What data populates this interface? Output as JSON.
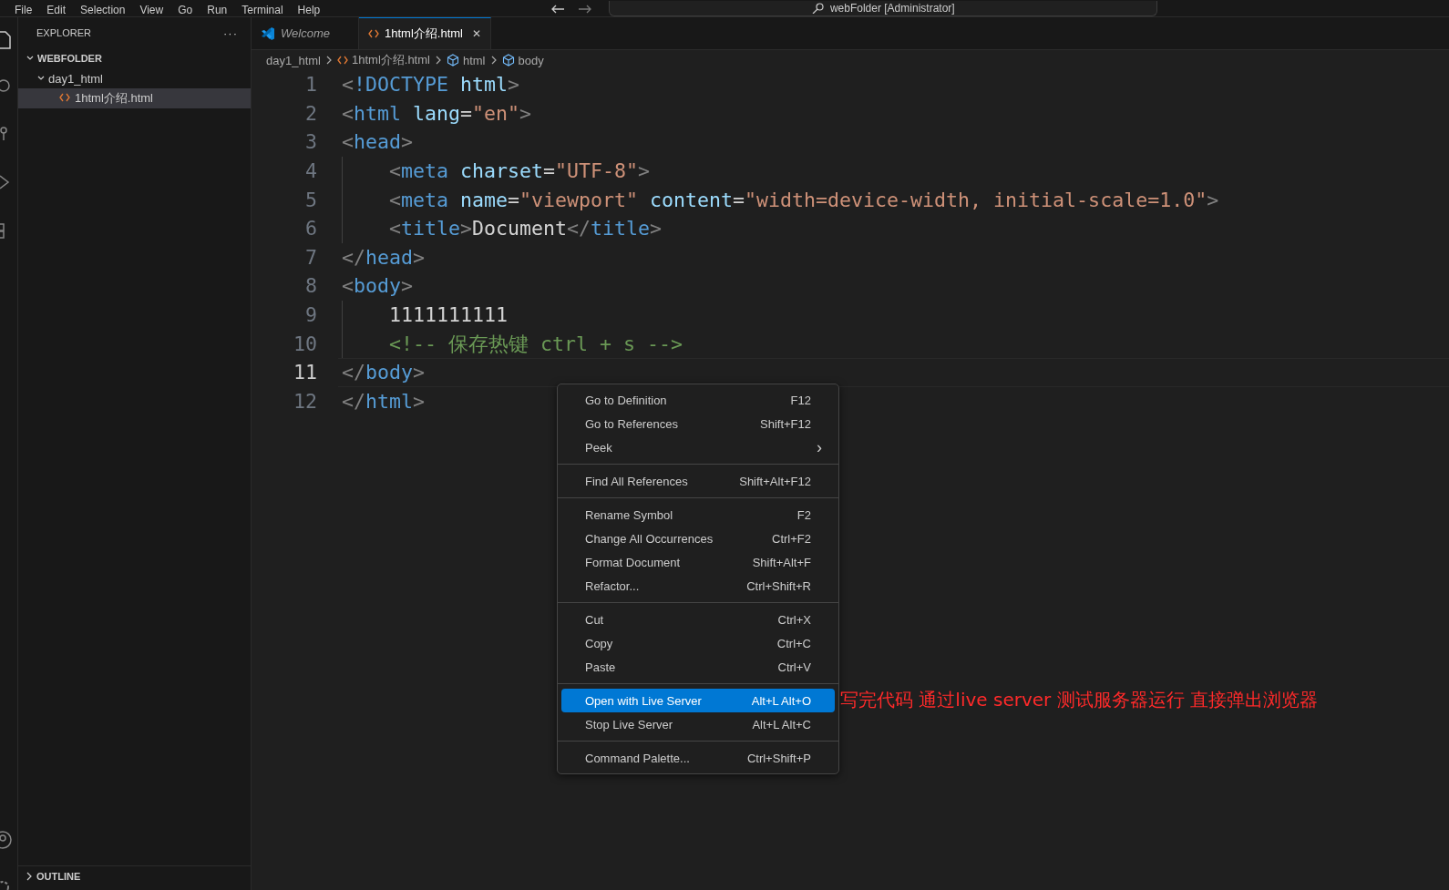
{
  "menu_bar": [
    "File",
    "Edit",
    "Selection",
    "View",
    "Go",
    "Run",
    "Terminal",
    "Help"
  ],
  "command_center": {
    "text": "webFolder [Administrator]"
  },
  "sidebar": {
    "title": "EXPLORER",
    "more": "···",
    "tree": [
      {
        "label": "WEBFOLDER",
        "kind": "root",
        "expanded": true,
        "selected": false,
        "children": [
          {
            "label": "day1_html",
            "expanded": true,
            "selected": false,
            "children": [
              {
                "label": "1html介绍.html",
                "kind": "file",
                "selected": true
              }
            ]
          }
        ]
      }
    ],
    "outline": {
      "label": "OUTLINE",
      "expanded": false
    }
  },
  "tabs": [
    {
      "label": "Welcome",
      "kind": "welcome",
      "selected": false,
      "close": false
    },
    {
      "label": "1html介绍.html",
      "kind": "html",
      "selected": true,
      "close": true
    }
  ],
  "close_glyph": "✕",
  "breadcrumb": [
    {
      "label": "day1_html",
      "kind": "folder"
    },
    {
      "label": "1html介绍.html",
      "kind": "html"
    },
    {
      "label": "html",
      "kind": "element"
    },
    {
      "label": "body",
      "kind": "element"
    }
  ],
  "code": [
    {
      "number": "1",
      "indented": false,
      "current": false,
      "tokens": [
        {
          "kind": "punct",
          "text": "<"
        },
        {
          "kind": "tag",
          "text": "!DOCTYPE"
        },
        {
          "kind": "attr",
          "text": " html"
        },
        {
          "kind": "punct",
          "text": ">"
        }
      ]
    },
    {
      "number": "2",
      "indented": false,
      "current": false,
      "tokens": [
        {
          "kind": "punct",
          "text": "<"
        },
        {
          "kind": "tag",
          "text": "html"
        },
        {
          "kind": "attr",
          "text": " lang"
        },
        {
          "kind": "plain",
          "text": "="
        },
        {
          "kind": "string",
          "text": "\"en\""
        },
        {
          "kind": "punct",
          "text": ">"
        }
      ]
    },
    {
      "number": "3",
      "indented": false,
      "current": false,
      "tokens": [
        {
          "kind": "punct",
          "text": "<"
        },
        {
          "kind": "tag",
          "text": "head"
        },
        {
          "kind": "punct",
          "text": ">"
        }
      ]
    },
    {
      "number": "4",
      "indented": true,
      "current": false,
      "tokens": [
        {
          "kind": "punct",
          "text": "<"
        },
        {
          "kind": "tag",
          "text": "meta"
        },
        {
          "kind": "attr",
          "text": " charset"
        },
        {
          "kind": "plain",
          "text": "="
        },
        {
          "kind": "string",
          "text": "\"UTF-8\""
        },
        {
          "kind": "punct",
          "text": ">"
        }
      ]
    },
    {
      "number": "5",
      "indented": true,
      "current": false,
      "tokens": [
        {
          "kind": "punct",
          "text": "<"
        },
        {
          "kind": "tag",
          "text": "meta"
        },
        {
          "kind": "attr",
          "text": " name"
        },
        {
          "kind": "plain",
          "text": "="
        },
        {
          "kind": "string",
          "text": "\"viewport\""
        },
        {
          "kind": "attr",
          "text": " content"
        },
        {
          "kind": "plain",
          "text": "="
        },
        {
          "kind": "string",
          "text": "\"width=device-width, initial-scale=1.0\""
        },
        {
          "kind": "punct",
          "text": ">"
        }
      ]
    },
    {
      "number": "6",
      "indented": true,
      "current": false,
      "tokens": [
        {
          "kind": "punct",
          "text": "<"
        },
        {
          "kind": "tag",
          "text": "title"
        },
        {
          "kind": "punct",
          "text": ">"
        },
        {
          "kind": "plain",
          "text": "Document"
        },
        {
          "kind": "punct",
          "text": "</"
        },
        {
          "kind": "tag",
          "text": "title"
        },
        {
          "kind": "punct",
          "text": ">"
        }
      ]
    },
    {
      "number": "7",
      "indented": false,
      "current": false,
      "tokens": [
        {
          "kind": "punct",
          "text": "</"
        },
        {
          "kind": "tag",
          "text": "head"
        },
        {
          "kind": "punct",
          "text": ">"
        }
      ]
    },
    {
      "number": "8",
      "indented": false,
      "current": false,
      "tokens": [
        {
          "kind": "punct",
          "text": "<"
        },
        {
          "kind": "tag",
          "text": "body"
        },
        {
          "kind": "punct",
          "text": ">"
        }
      ]
    },
    {
      "number": "9",
      "indented": true,
      "current": false,
      "tokens": [
        {
          "kind": "plain",
          "text": "1111111111"
        }
      ]
    },
    {
      "number": "10",
      "indented": true,
      "current": false,
      "tokens": [
        {
          "kind": "comment",
          "text": "<!-- 保存热键 ctrl + s -->"
        }
      ]
    },
    {
      "number": "11",
      "indented": false,
      "current": true,
      "tokens": [
        {
          "kind": "punct",
          "text": "</"
        },
        {
          "kind": "tag",
          "text": "body"
        },
        {
          "kind": "punct",
          "text": ">"
        }
      ]
    },
    {
      "number": "12",
      "indented": false,
      "current": false,
      "tokens": [
        {
          "kind": "punct",
          "text": "</"
        },
        {
          "kind": "tag",
          "text": "html"
        },
        {
          "kind": "punct",
          "text": ">"
        }
      ]
    }
  ],
  "context_menu": {
    "submenu_glyph": "›",
    "groups": [
      [
        {
          "label": "Go to Definition",
          "shortcut": "F12",
          "submenu": false,
          "selected": false
        },
        {
          "label": "Go to References",
          "shortcut": "Shift+F12",
          "submenu": false,
          "selected": false
        },
        {
          "label": "Peek",
          "submenu": true,
          "selected": false
        }
      ],
      [
        {
          "label": "Find All References",
          "shortcut": "Shift+Alt+F12",
          "submenu": false,
          "selected": false
        }
      ],
      [
        {
          "label": "Rename Symbol",
          "shortcut": "F2",
          "submenu": false,
          "selected": false
        },
        {
          "label": "Change All Occurrences",
          "shortcut": "Ctrl+F2",
          "submenu": false,
          "selected": false
        },
        {
          "label": "Format Document",
          "shortcut": "Shift+Alt+F",
          "submenu": false,
          "selected": false
        },
        {
          "label": "Refactor...",
          "shortcut": "Ctrl+Shift+R",
          "submenu": false,
          "selected": false
        }
      ],
      [
        {
          "label": "Cut",
          "shortcut": "Ctrl+X",
          "submenu": false,
          "selected": false
        },
        {
          "label": "Copy",
          "shortcut": "Ctrl+C",
          "submenu": false,
          "selected": false
        },
        {
          "label": "Paste",
          "shortcut": "Ctrl+V",
          "submenu": false,
          "selected": false
        }
      ],
      [
        {
          "label": "Open with Live Server",
          "shortcut": "Alt+L Alt+O",
          "submenu": false,
          "selected": true
        },
        {
          "label": "Stop Live Server",
          "shortcut": "Alt+L Alt+C",
          "submenu": false,
          "selected": false
        }
      ],
      [
        {
          "label": "Command Palette...",
          "shortcut": "Ctrl+Shift+P",
          "submenu": false,
          "selected": false
        }
      ]
    ]
  },
  "annotation": "写完代码 通过live server 测试服务器运行 直接弹出浏览器"
}
